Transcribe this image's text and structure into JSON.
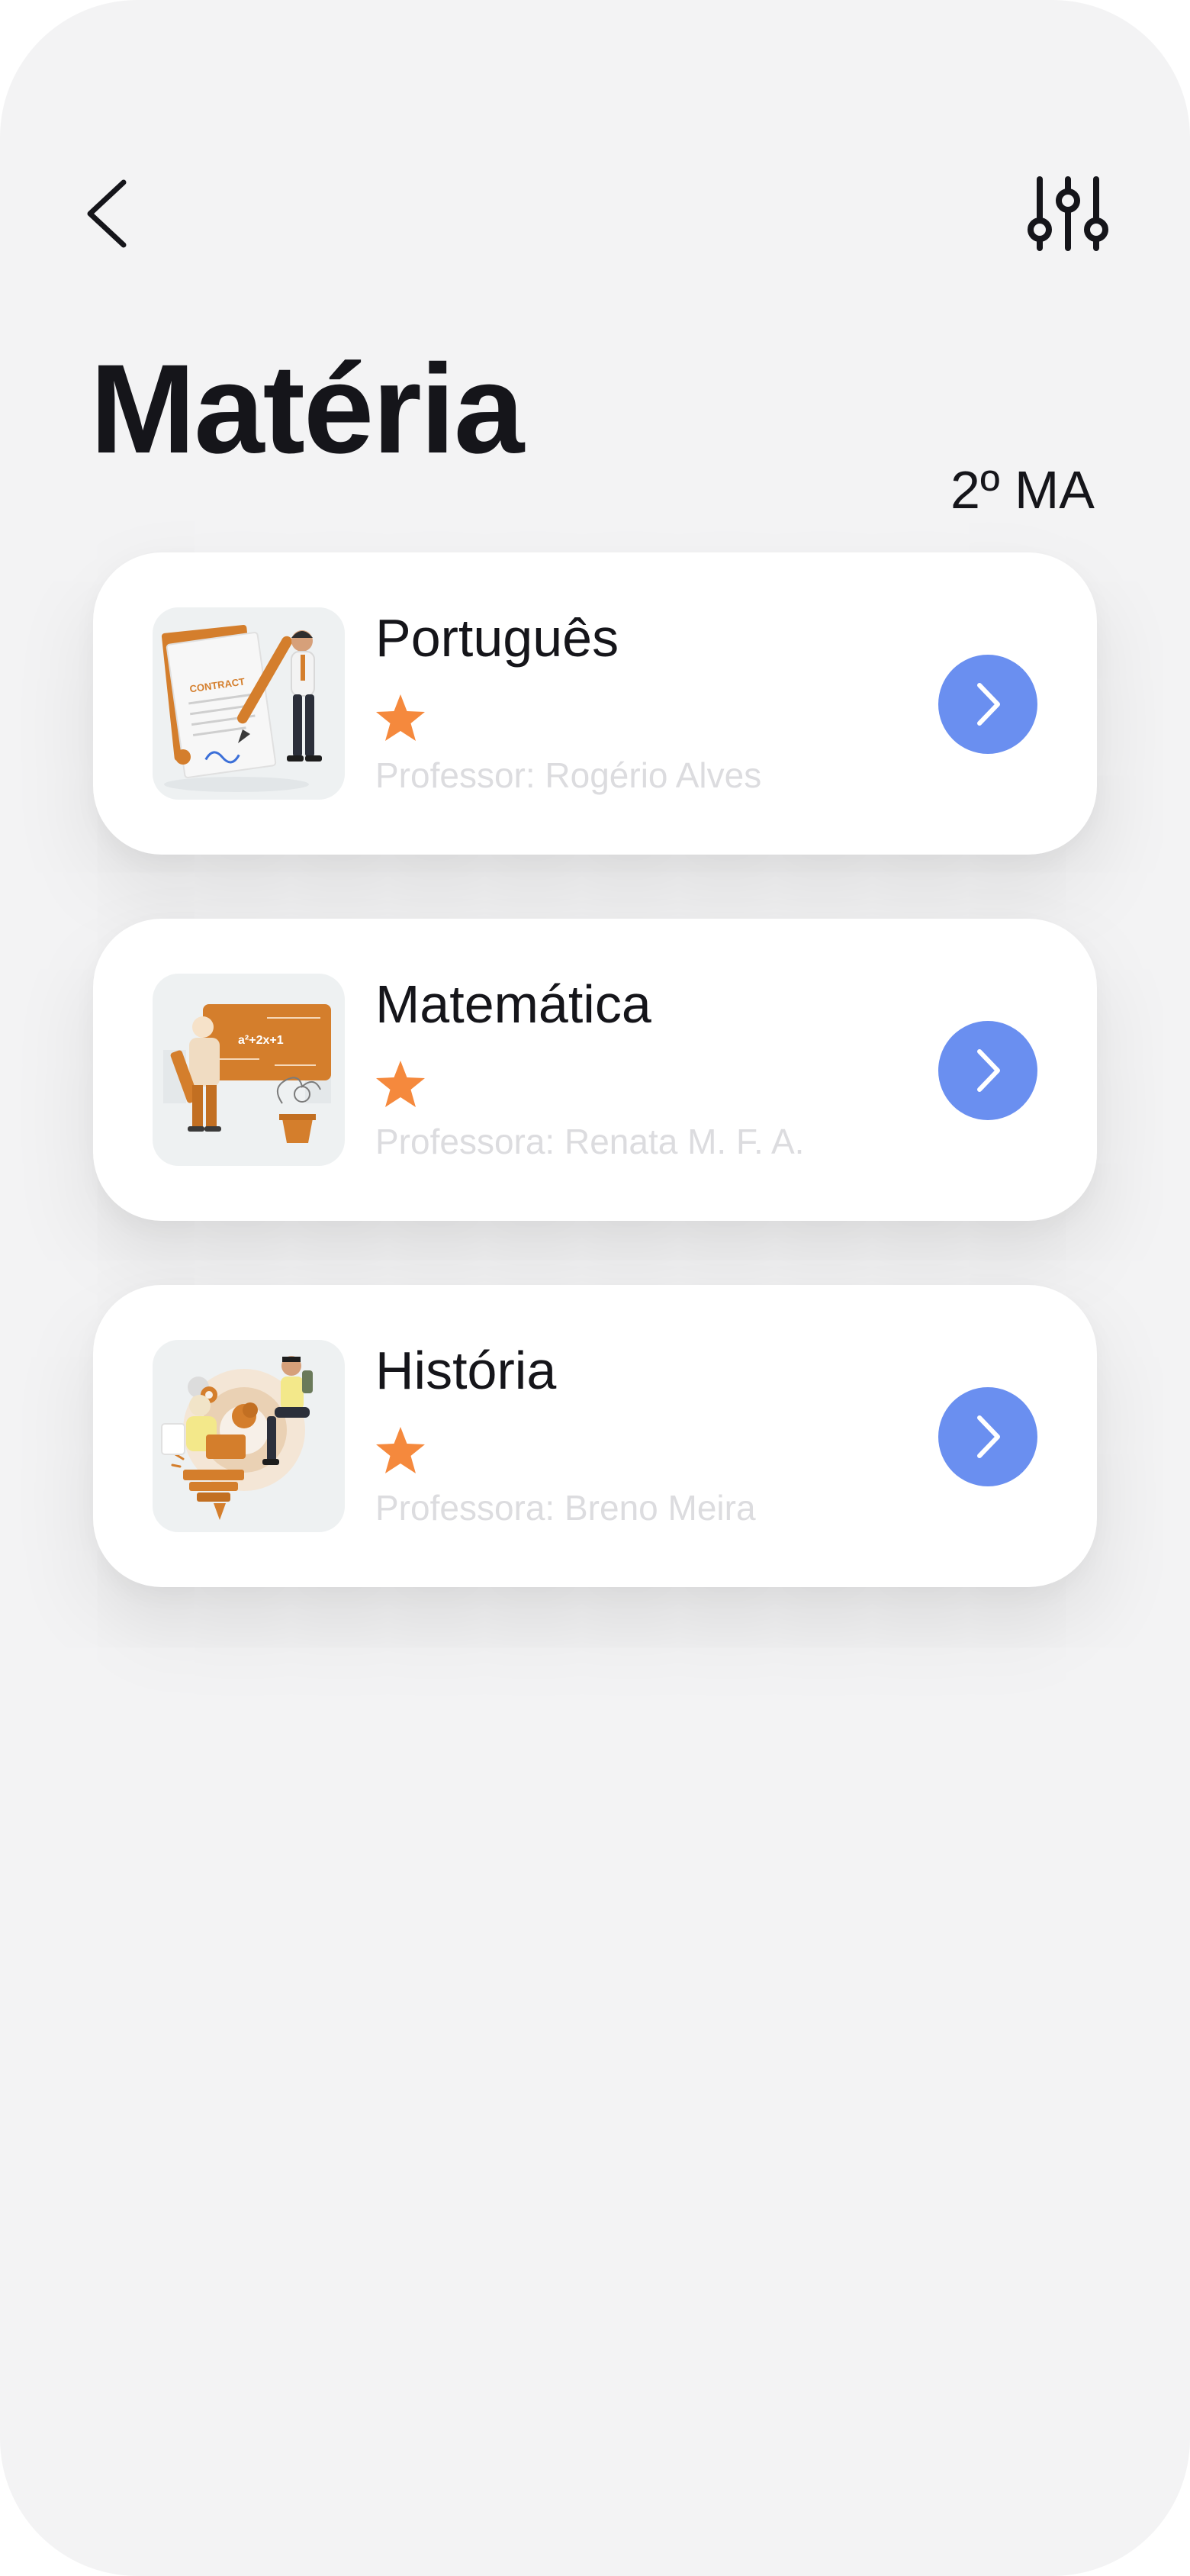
{
  "header": {
    "title": "Matéria",
    "class_label": "2º MA"
  },
  "icons": {
    "back": "chevron-left-icon",
    "filter": "sliders-icon",
    "rating": "star-icon",
    "open": "chevron-right-icon"
  },
  "colors": {
    "background": "#f3f3f4",
    "card": "#ffffff",
    "accent_blue": "#6a8ff0",
    "star_orange": "#f5893d",
    "illustration_orange": "#d47e2c",
    "title_text": "#15151a",
    "teacher_text": "#dcdcdf"
  },
  "subjects": [
    {
      "name": "Português",
      "teacher": "Professor: Rogério Alves",
      "rating_stars": 1,
      "illustration": "contract-writing-illustration",
      "thumb_text": "CONTRACT"
    },
    {
      "name": "Matemática",
      "teacher": "Professora: Renata M. F. A.",
      "rating_stars": 1,
      "illustration": "math-teacher-chalkboard-illustration",
      "thumb_text": "a²+2x+1"
    },
    {
      "name": "História",
      "teacher": "Professora: Breno Meira",
      "rating_stars": 1,
      "illustration": "history-study-illustration"
    }
  ]
}
